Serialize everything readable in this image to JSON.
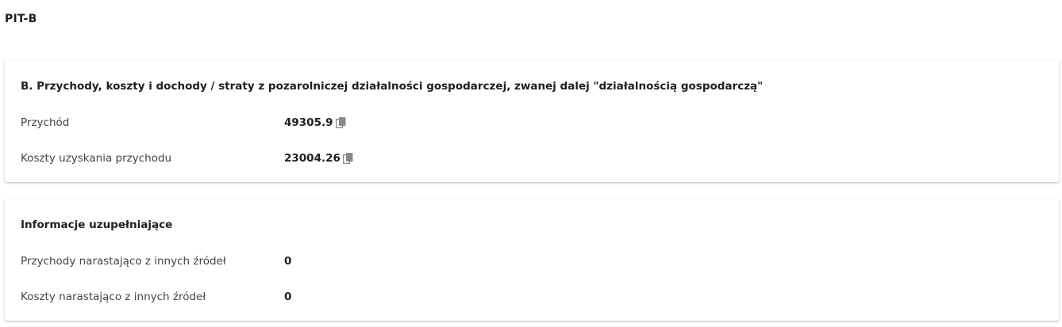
{
  "page": {
    "title": "PIT-B"
  },
  "section_b": {
    "title": "B. Przychody, koszty i dochody / straty z pozarolniczej działalności gospodarczej, zwanej dalej \"działalnością gospodarczą\"",
    "rows": [
      {
        "label": "Przychód",
        "value": "49305.9",
        "copy_icon": "copy-icon"
      },
      {
        "label": "Koszty uzyskania przychodu",
        "value": "23004.26",
        "copy_icon": "copy-icon"
      }
    ]
  },
  "supplementary": {
    "title": "Informacje uzupełniające",
    "rows": [
      {
        "label": "Przychody narastająco z innych źródeł",
        "value": "0"
      },
      {
        "label": "Koszty narastająco z innych źródeł",
        "value": "0"
      }
    ]
  },
  "colors": {
    "icon": "#8a8a8a"
  }
}
